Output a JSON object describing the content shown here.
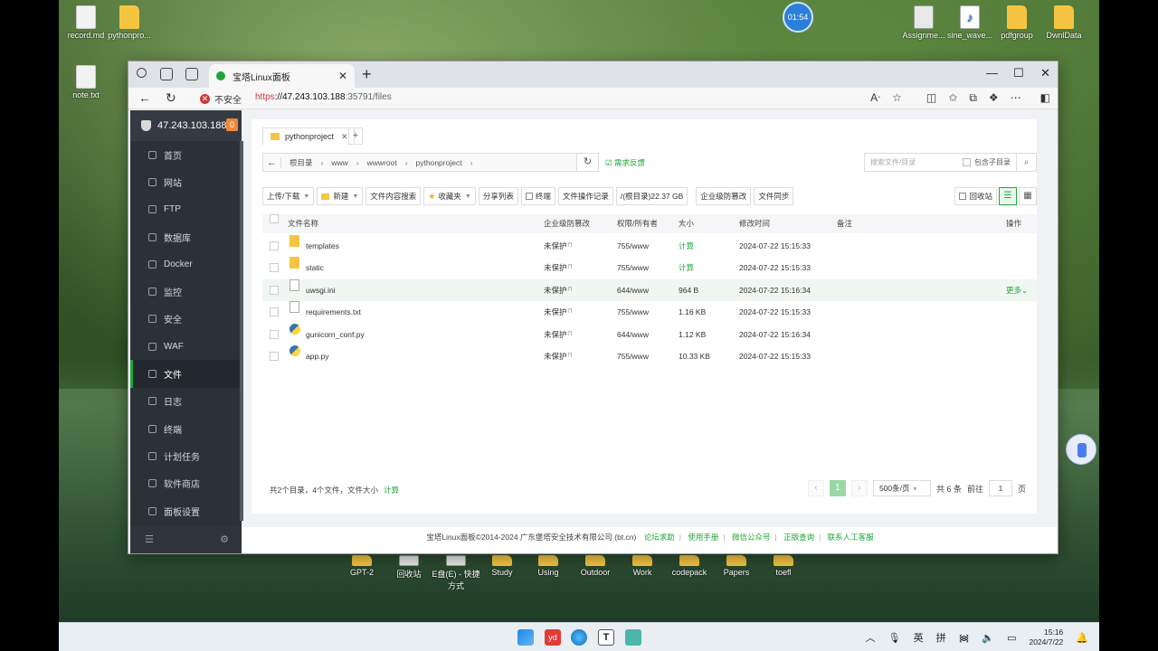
{
  "desktop": {
    "icons": [
      {
        "label": "record.md",
        "type": "file"
      },
      {
        "label": "pythonpro...",
        "type": "folder"
      },
      {
        "label": "note.txt",
        "type": "file"
      },
      {
        "label": "Assignme...",
        "type": "doc"
      },
      {
        "label": "sine_wave...",
        "type": "mp3"
      },
      {
        "label": "pdfgroup",
        "type": "folder"
      },
      {
        "label": "DwnlData",
        "type": "folder"
      }
    ],
    "bottom_icons": [
      "GPT-2",
      "回收站",
      "E盘(E) - 快捷方式",
      "Study",
      "Using",
      "Outdoor",
      "Work",
      "codepack",
      "Papers",
      "toefl"
    ],
    "timer": "01:54"
  },
  "browser": {
    "tab_title": "宝塔Linux面板",
    "security_label": "不安全",
    "url_scheme": "https",
    "url_host": "://47.243.103.188",
    "url_path": ":35791/files"
  },
  "sidebar": {
    "server_ip": "47.243.103.188",
    "badge": "0",
    "items": [
      {
        "label": "首页",
        "icon": "home-icon"
      },
      {
        "label": "网站",
        "icon": "globe-icon"
      },
      {
        "label": "FTP",
        "icon": "ftp-icon"
      },
      {
        "label": "数据库",
        "icon": "database-icon"
      },
      {
        "label": "Docker",
        "icon": "docker-icon"
      },
      {
        "label": "监控",
        "icon": "monitor-icon"
      },
      {
        "label": "安全",
        "icon": "shield-icon"
      },
      {
        "label": "WAF",
        "icon": "firewall-icon"
      },
      {
        "label": "文件",
        "icon": "folder-icon"
      },
      {
        "label": "日志",
        "icon": "log-icon"
      },
      {
        "label": "终端",
        "icon": "terminal-icon"
      },
      {
        "label": "计划任务",
        "icon": "clock-icon"
      },
      {
        "label": "软件商店",
        "icon": "store-icon"
      },
      {
        "label": "面板设置",
        "icon": "settings-icon"
      }
    ],
    "active_index": 8
  },
  "files": {
    "folder_tab": "pythonproject",
    "breadcrumb": [
      "根目录",
      "www",
      "wwwroot",
      "pythonproject"
    ],
    "feedback": "需求反馈",
    "search_placeholder": "搜索文件/目录",
    "include_sub": "包含子目录",
    "toolbar": {
      "upload": "上传/下载",
      "new": "新建",
      "content_search": "文件内容搜索",
      "favorites": "收藏夹",
      "share": "分享列表",
      "compress": "终端",
      "ops_log": "文件操作记录",
      "disk": "/(根目录)22.37 GB",
      "tamper": "企业级防篡改",
      "sync": "文件同步",
      "recycle": "回收站"
    },
    "columns": {
      "name": "文件名称",
      "protect": "企业级防篡改",
      "perm": "权限/所有者",
      "size": "大小",
      "mtime": "修改时间",
      "note": "备注",
      "action": "操作"
    },
    "rows": [
      {
        "name": "templates",
        "type": "folder",
        "protect": "未保护",
        "perm": "755/www",
        "size": "计算",
        "mtime": "2024-07-22 15:15:33",
        "more": ""
      },
      {
        "name": "static",
        "type": "folder",
        "protect": "未保护",
        "perm": "755/www",
        "size": "计算",
        "mtime": "2024-07-22 15:15:33",
        "more": ""
      },
      {
        "name": "uwsgi.ini",
        "type": "file",
        "protect": "未保护",
        "perm": "644/www",
        "size": "964 B",
        "mtime": "2024-07-22 15:16:34",
        "more": "更多"
      },
      {
        "name": "requirements.txt",
        "type": "file",
        "protect": "未保护",
        "perm": "755/www",
        "size": "1.16 KB",
        "mtime": "2024-07-22 15:15:33",
        "more": ""
      },
      {
        "name": "gunicorn_conf.py",
        "type": "py",
        "protect": "未保护",
        "perm": "644/www",
        "size": "1.12 KB",
        "mtime": "2024-07-22 15:16:34",
        "more": ""
      },
      {
        "name": "app.py",
        "type": "py",
        "protect": "未保护",
        "perm": "755/www",
        "size": "10.33 KB",
        "mtime": "2024-07-22 15:15:33",
        "more": ""
      }
    ],
    "summary": "共2个目录，4个文件，文件大小",
    "summary_calc": "计算",
    "pager": {
      "current": "1",
      "page_size": "500条/页",
      "total": "共 6 条",
      "goto_label": "前往",
      "goto_value": "1",
      "page_unit": "页"
    }
  },
  "copyright": {
    "text": "宝塔Linux面板©2014-2024 广东堡塔安全技术有限公司 (bt.cn)",
    "links": [
      "论坛求助",
      "使用手册",
      "微信公众号",
      "正版查询",
      "联系人工客服"
    ]
  },
  "taskbar": {
    "lang1": "英",
    "lang2": "拼",
    "time": "15:16",
    "date": "2024/7/22"
  },
  "colors": {
    "accent": "#20a53a",
    "sidebar_bg": "#2c3138"
  }
}
